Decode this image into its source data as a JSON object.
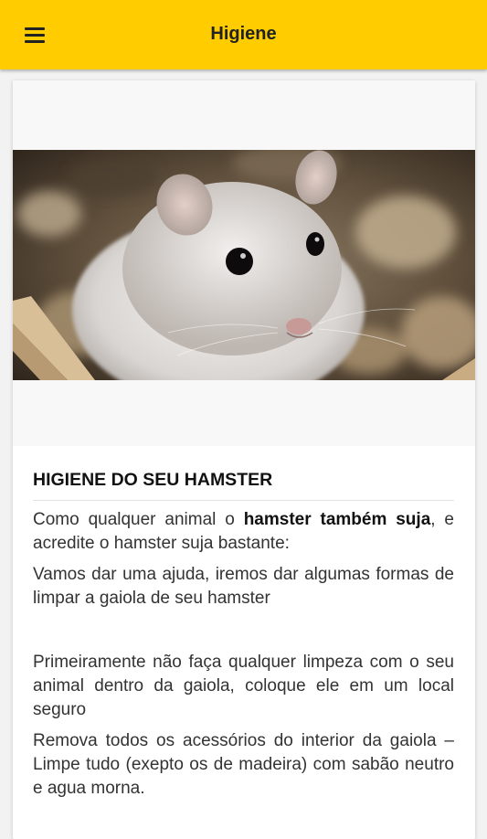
{
  "appbar": {
    "title": "Higiene",
    "menu_icon": "hamburger-menu-icon",
    "background": "#ffcc00"
  },
  "article": {
    "image_alt": "Hamster",
    "heading": "HIGIENE DO SEU HAMSTER",
    "paragraph1_pre": "Como qualquer animal o ",
    "paragraph1_bold": "hamster também suja",
    "paragraph1_post": ", e acredite o hamster suja bastante:",
    "paragraph2": "Vamos dar uma ajuda, iremos dar algumas formas de limpar a gaiola de seu hamster",
    "paragraph3": "Primeiramente não faça qualquer limpeza com o seu animal dentro da gaiola, coloque ele em um local seguro",
    "paragraph4": "Remova todos os acessórios do interior da gaiola – Limpe tudo (exepto os de madeira)  com sabão neutro e agua morna."
  }
}
